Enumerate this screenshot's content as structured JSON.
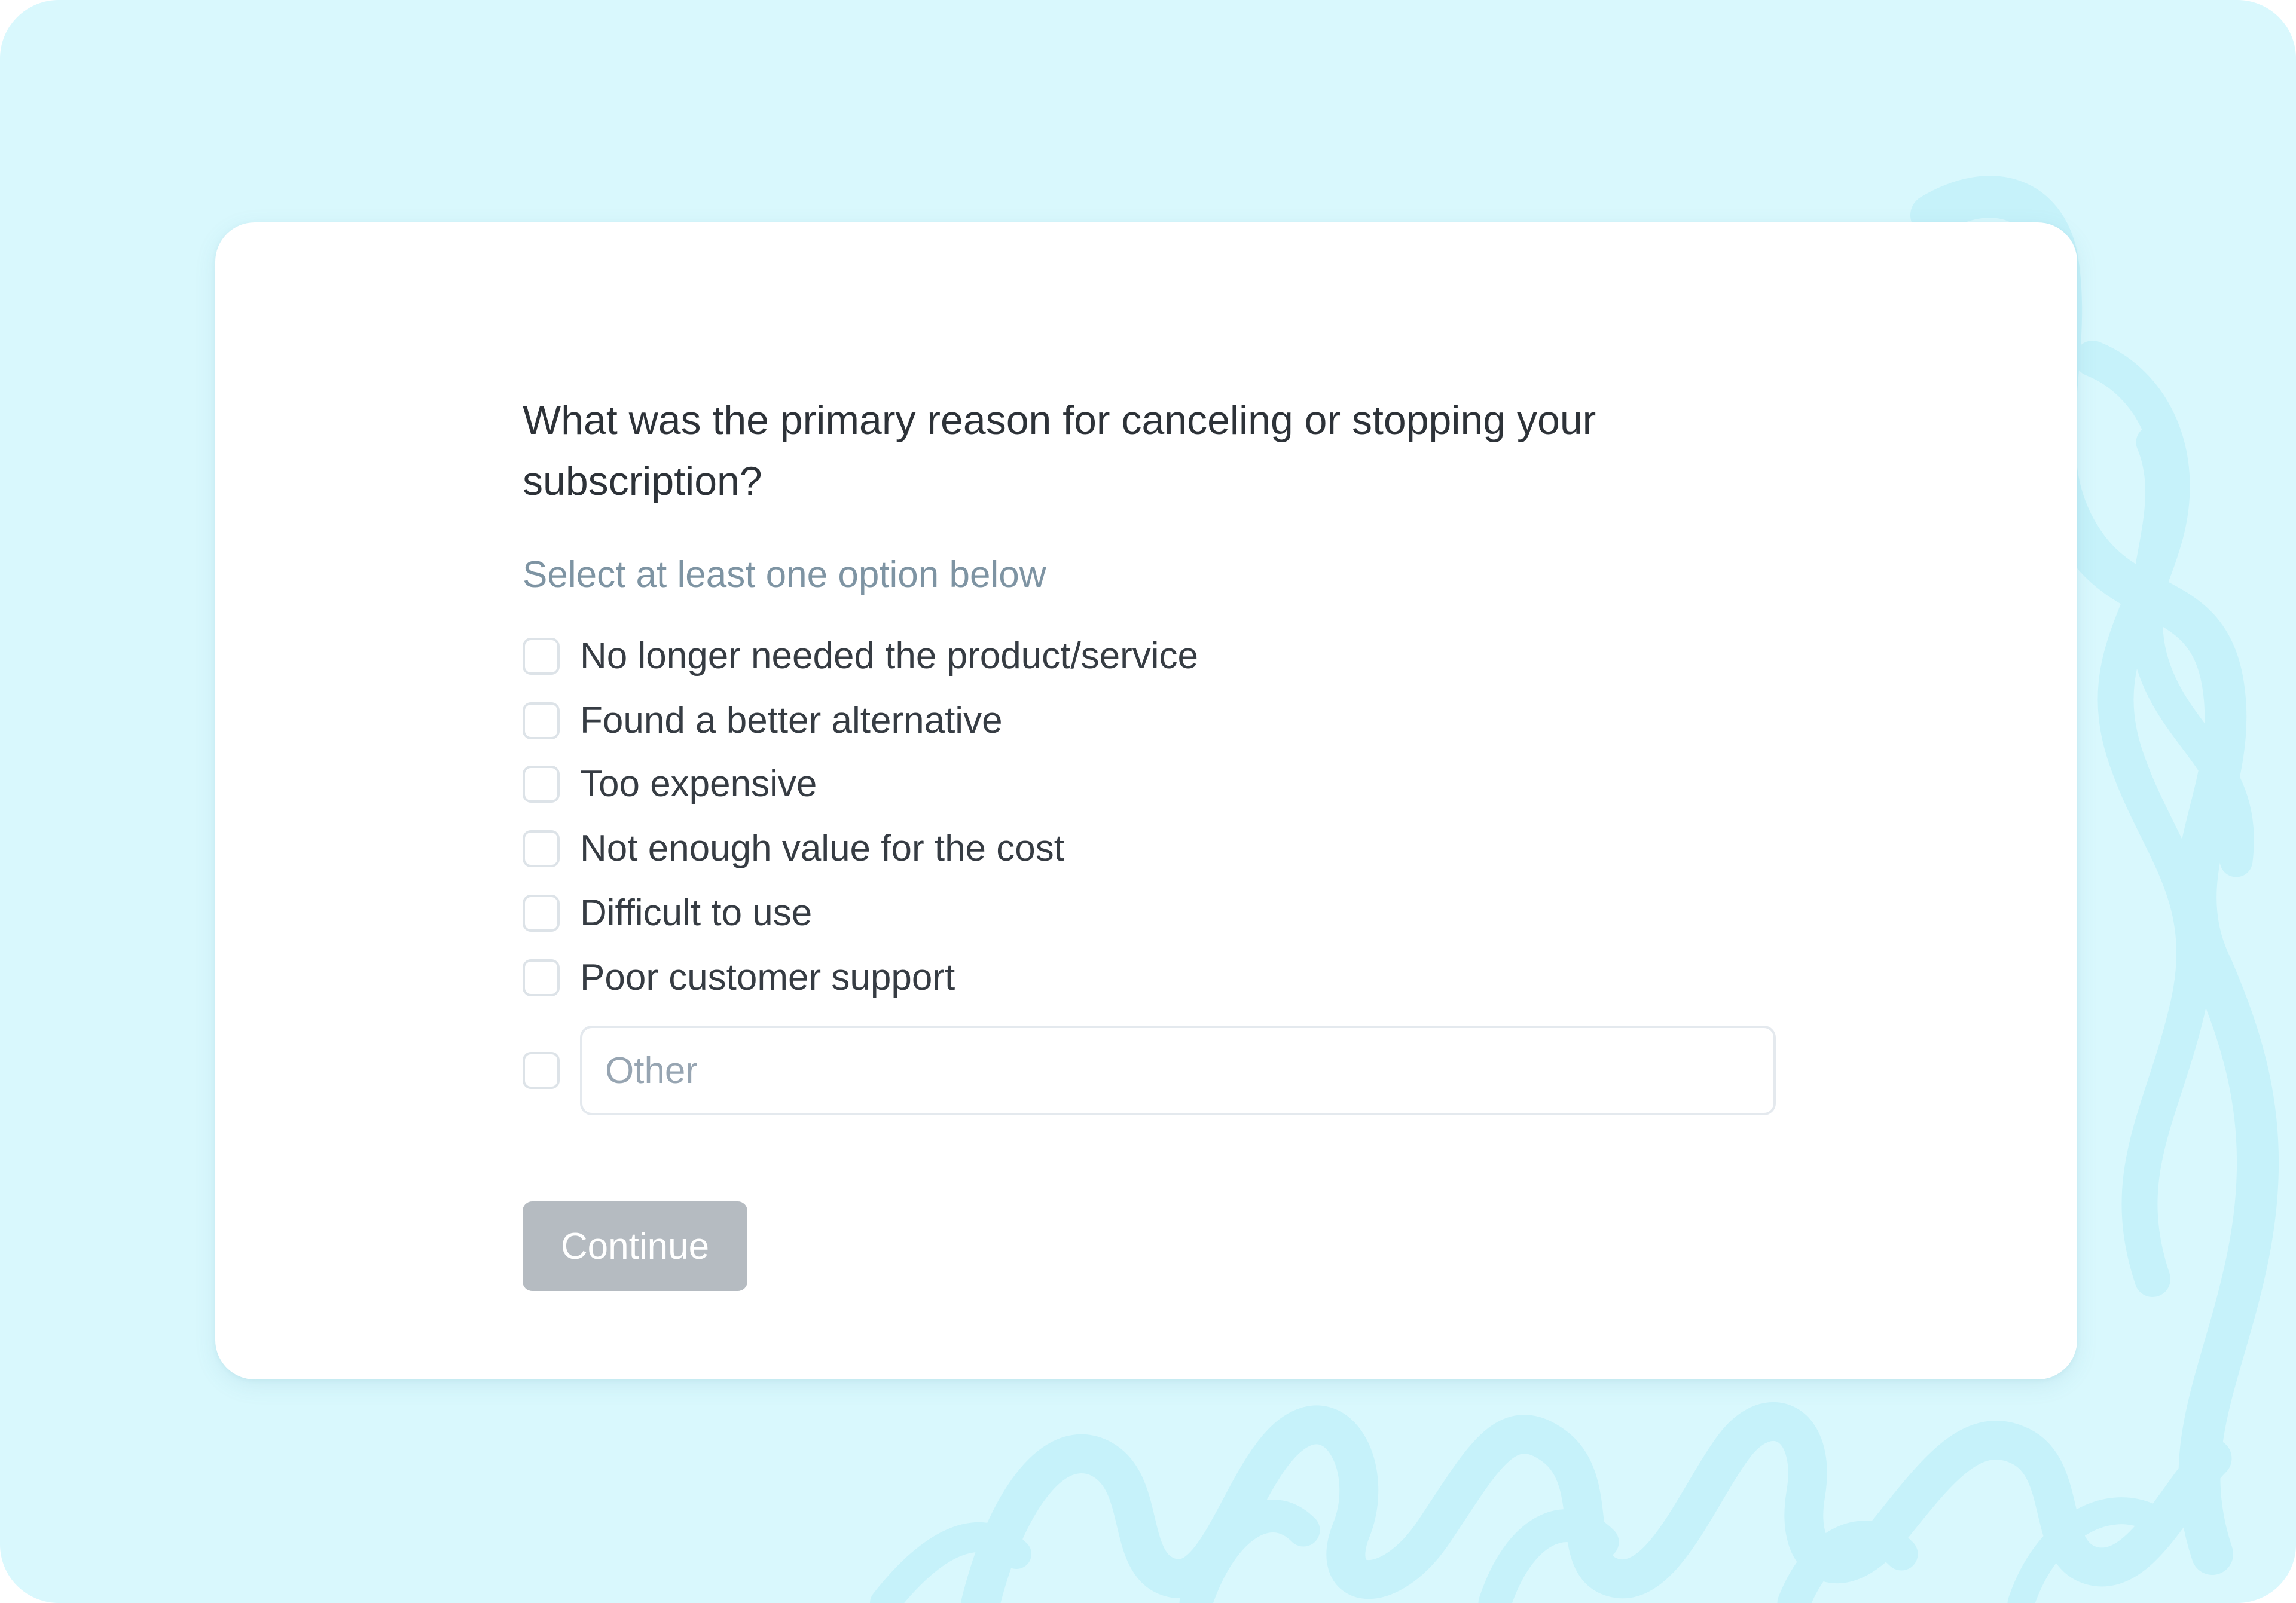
{
  "survey": {
    "question": "What was the primary reason for canceling or stopping your subscription?",
    "hint": "Select at least one option below",
    "options": [
      {
        "label": "No longer needed the product/service",
        "checked": false
      },
      {
        "label": "Found a better alternative",
        "checked": false
      },
      {
        "label": "Too expensive",
        "checked": false
      },
      {
        "label": "Not enough value for the cost",
        "checked": false
      },
      {
        "label": "Difficult to use",
        "checked": false
      },
      {
        "label": "Poor customer support",
        "checked": false
      }
    ],
    "other": {
      "placeholder": "Other",
      "value": "",
      "checked": false
    },
    "continue_label": "Continue",
    "continue_enabled": false
  },
  "colors": {
    "background": "#d9f8fd",
    "card": "#ffffff",
    "question_text": "#2d3238",
    "hint_text": "#7e94a3",
    "button_disabled": "#b5bbc1"
  }
}
